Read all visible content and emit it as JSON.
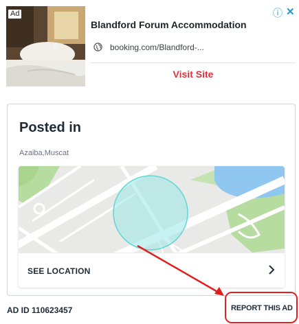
{
  "ad": {
    "badge": "Ad",
    "info_icon": "info-icon",
    "close_icon": "close-icon",
    "title": "Blandford Forum Accommodation",
    "url": "booking.com/Blandford-...",
    "cta": "Visit Site"
  },
  "posted": {
    "title": "Posted in",
    "location": "Azaiba,Muscat",
    "see_location": "SEE LOCATION"
  },
  "footer": {
    "ad_id": "AD ID 110623457",
    "report": "REPORT THIS AD"
  },
  "colors": {
    "accent_blue": "#1a9bd7",
    "cta_red": "#e0313b",
    "annotation_red": "#e02020",
    "map_circle": "#5fd6d6",
    "water": "#8fc7f0",
    "park": "#b7dca0"
  }
}
